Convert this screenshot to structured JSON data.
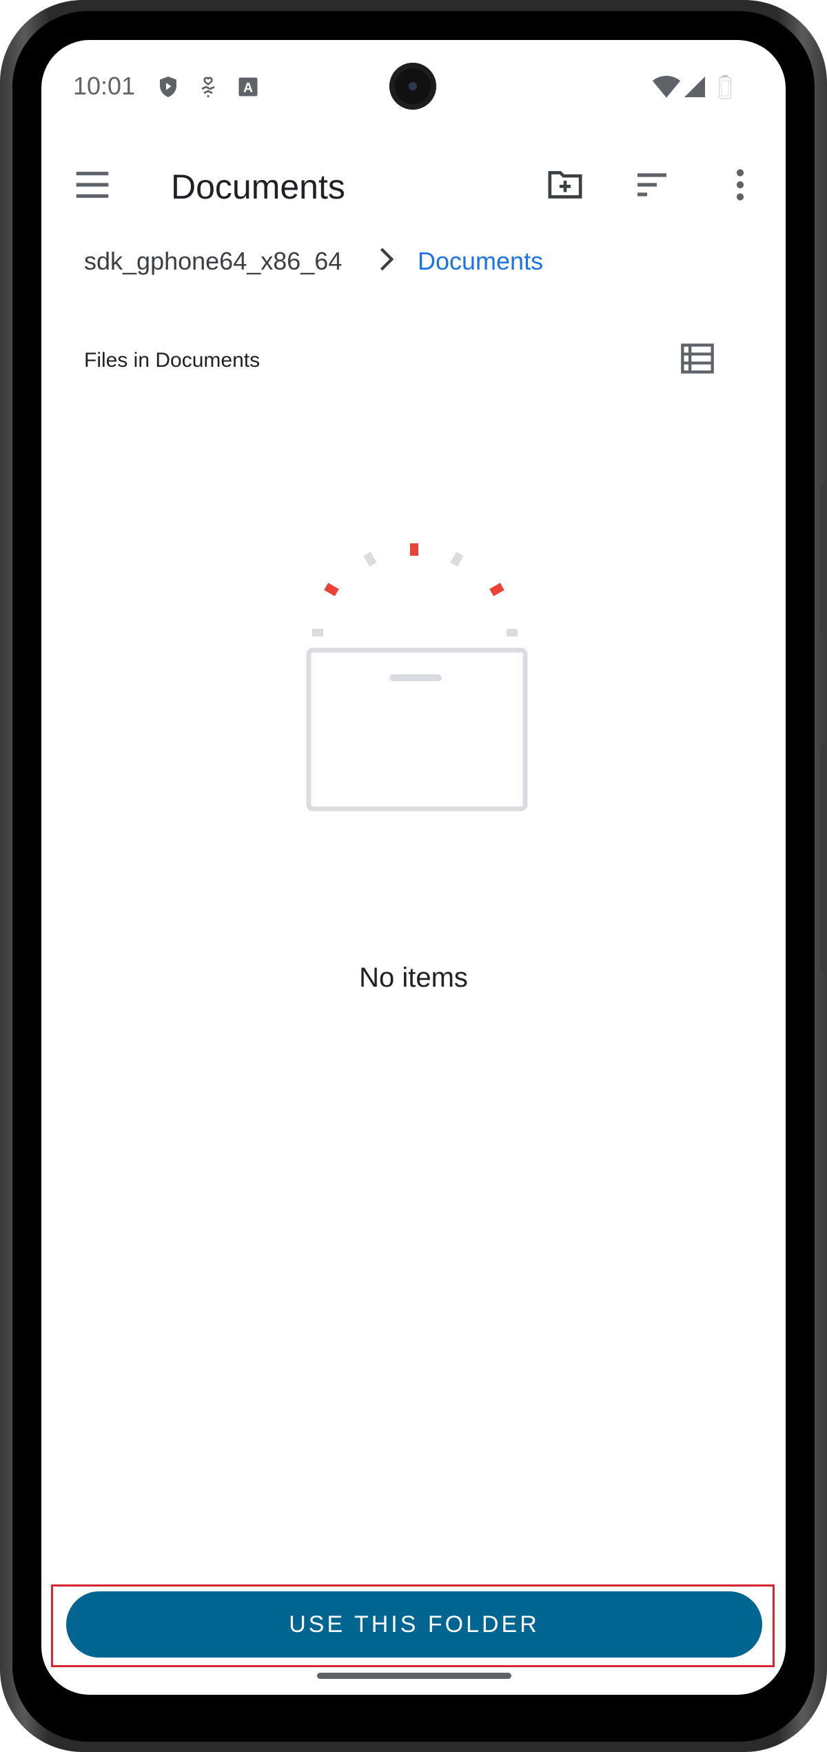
{
  "status_bar": {
    "time": "10:01",
    "icons": [
      "shield-play-icon",
      "hand-heart-icon",
      "font-a-icon",
      "wifi-icon",
      "cellular-signal-icon",
      "battery-icon"
    ]
  },
  "app_bar": {
    "menu_icon": "menu-icon",
    "title": "Documents",
    "actions": [
      "new-folder-icon",
      "sort-icon",
      "more-vert-icon"
    ]
  },
  "breadcrumb": {
    "root": "sdk_gphone64_x86_64",
    "current": "Documents"
  },
  "files": {
    "header": "Files in Documents",
    "view_toggle_icon": "list-view-icon"
  },
  "empty_state": {
    "message": "No items"
  },
  "bottom": {
    "use_button_label": "USE THIS FOLDER"
  },
  "colors": {
    "accent_blue": "#1a73e8",
    "button_bg": "#006691",
    "highlight_border": "#d9252f",
    "empty_art_gray": "#dadce0",
    "empty_art_red": "#ea4335"
  }
}
